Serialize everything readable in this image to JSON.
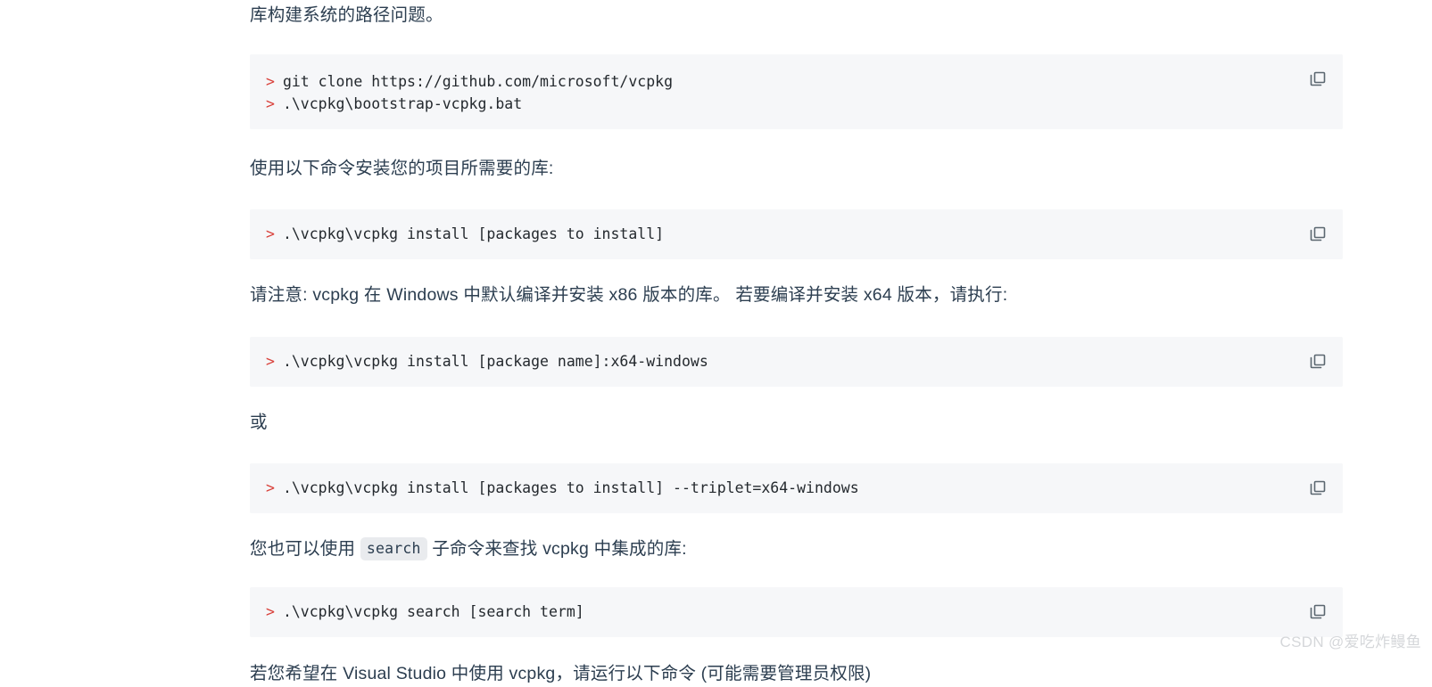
{
  "document": {
    "blocks": [
      {
        "kind": "paragraph",
        "name": "paragraph-path-issue",
        "text": "库构建系统的路径问题。"
      },
      {
        "kind": "code",
        "name": "code-block-clone-bootstrap",
        "lines": [
          "git clone https://github.com/microsoft/vcpkg",
          ".\\vcpkg\\bootstrap-vcpkg.bat"
        ],
        "prompt": ">",
        "copy_icon": "copy-icon"
      },
      {
        "kind": "paragraph",
        "name": "paragraph-install-libs",
        "text": "使用以下命令安装您的项目所需要的库:"
      },
      {
        "kind": "code",
        "name": "code-block-install-packages",
        "lines": [
          ".\\vcpkg\\vcpkg install [packages to install]"
        ],
        "prompt": ">",
        "copy_icon": "copy-icon"
      },
      {
        "kind": "paragraph",
        "name": "paragraph-x86-x64-note",
        "text": "请注意: vcpkg 在 Windows 中默认编译并安装 x86 版本的库。 若要编译并安装 x64 版本，请执行:"
      },
      {
        "kind": "code",
        "name": "code-block-install-x64-windows",
        "lines": [
          ".\\vcpkg\\vcpkg install [package name]:x64-windows"
        ],
        "prompt": ">",
        "copy_icon": "copy-icon"
      },
      {
        "kind": "paragraph",
        "name": "paragraph-or",
        "text": "或"
      },
      {
        "kind": "code",
        "name": "code-block-install-triplet-x64",
        "lines": [
          ".\\vcpkg\\vcpkg install [packages to install] --triplet=x64-windows"
        ],
        "prompt": ">",
        "copy_icon": "copy-icon"
      },
      {
        "kind": "paragraph-inline-code",
        "name": "paragraph-search-subcommand",
        "text_before": "您也可以使用 ",
        "code": "search",
        "text_after": " 子命令来查找 vcpkg 中集成的库:"
      },
      {
        "kind": "code",
        "name": "code-block-search-term",
        "lines": [
          ".\\vcpkg\\vcpkg search [search term]"
        ],
        "prompt": ">",
        "copy_icon": "copy-icon"
      },
      {
        "kind": "paragraph",
        "name": "paragraph-visual-studio-integrate",
        "text": "若您希望在 Visual Studio 中使用 vcpkg，请运行以下命令 (可能需要管理员权限)"
      }
    ]
  },
  "watermark": {
    "text": "CSDN @爱吃炸鳗鱼"
  },
  "colors": {
    "code_block_background": "#f6f7f9",
    "prompt_red": "#d9413b",
    "text": "#2c3e50",
    "inline_code_background": "#e9ebee",
    "copy_icon": "#5b6770",
    "watermark": "#d5d7da"
  }
}
